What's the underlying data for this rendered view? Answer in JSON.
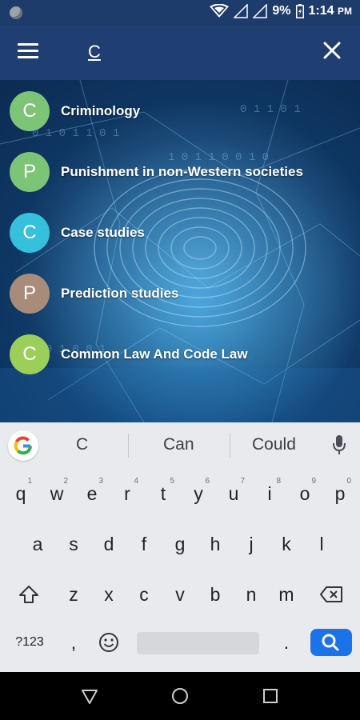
{
  "status": {
    "battery": "9%",
    "time": "1:14",
    "ampm": "PM"
  },
  "search": {
    "query": "C"
  },
  "results": [
    {
      "letter": "C",
      "label": "Criminology",
      "color": "#7cc576"
    },
    {
      "letter": "P",
      "label": "Punishment in non-Western societies",
      "color": "#7cc576"
    },
    {
      "letter": "C",
      "label": "Case studies",
      "color": "#35c0db"
    },
    {
      "letter": "P",
      "label": "Prediction studies",
      "color": "#a98b79"
    },
    {
      "letter": "C",
      "label": "Common Law And Code Law",
      "color": "#9ccf5a"
    }
  ],
  "keyboard": {
    "suggestions": [
      "C",
      "Can",
      "Could"
    ],
    "row1": [
      "q",
      "w",
      "e",
      "r",
      "t",
      "y",
      "u",
      "i",
      "o",
      "p"
    ],
    "row1_sup": [
      "1",
      "2",
      "3",
      "4",
      "5",
      "6",
      "7",
      "8",
      "9",
      "0"
    ],
    "row2": [
      "a",
      "s",
      "d",
      "f",
      "g",
      "h",
      "j",
      "k",
      "l"
    ],
    "row3": [
      "z",
      "x",
      "c",
      "v",
      "b",
      "n",
      "m"
    ],
    "symbols_label": "?123",
    "comma": ",",
    "period": "."
  },
  "colors": {
    "accent": "#1a73e8",
    "appbar": "#1f3f73"
  }
}
